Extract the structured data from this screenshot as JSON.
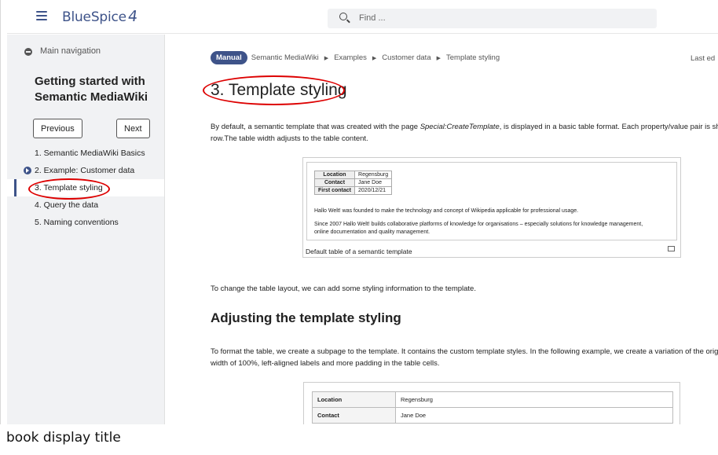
{
  "topbar": {
    "logo_text": "BlueSpice",
    "logo_suffix": "4",
    "search_placeholder": "Find ..."
  },
  "sidebar": {
    "main_navigation": "Main navigation",
    "book_title": "Getting started with Semantic MediaWiki",
    "previous_label": "Previous",
    "next_label": "Next",
    "items": [
      {
        "label": "1. Semantic MediaWiki Basics"
      },
      {
        "label": "2. Example: Customer data"
      },
      {
        "label": "3. Template styling"
      },
      {
        "label": "4. Query the data"
      },
      {
        "label": "5. Naming conventions"
      }
    ]
  },
  "breadcrumb": {
    "badge": "Manual",
    "items": [
      "Semantic MediaWiki",
      "Examples",
      "Customer data",
      "Template styling"
    ],
    "last_edit": "Last ed"
  },
  "content": {
    "title": "3. Template styling",
    "intro_line1_a": "By default, a semantic template that was created with the page ",
    "intro_line1_em": "Special:CreateTemplate",
    "intro_line1_b": ", is displayed in a basic table format. Each property/value pair is shown i",
    "intro_line2": "row.The table width adjusts to the table content.",
    "figure": {
      "rows": [
        {
          "key": "Location",
          "value": "Regensburg"
        },
        {
          "key": "Contact",
          "value": "Jane Doe"
        },
        {
          "key": "First contact",
          "value": "2020/12/21"
        }
      ],
      "text1": "Hallo Welt! was founded to make the technology and concept of Wikipedia applicable for professional usage.",
      "text2a": "Since 2007 Hallo Welt! builds collaborative platforms of knowledge for organisations – especially solutions for knowledge management,",
      "text2b": "online documentation and quality management.",
      "caption": "Default table of a semantic template"
    },
    "change_text": "To change the table layout, we can add some styling information to the template.",
    "heading2": "Adjusting the template styling",
    "format_line1": "To format the table, we create a subpage to the template. It contains the custom template styles. In the following example, we create a variation of the origina",
    "format_line2": "width of 100%, left-aligned labels and more padding in the table cells.",
    "table2": [
      {
        "key": "Location",
        "value": "Regensburg"
      },
      {
        "key": "Contact",
        "value": "Jane Doe"
      }
    ]
  },
  "bottom_caption": "book display title",
  "colors": {
    "brand": "#3e5389",
    "highlight": "#dd0000"
  }
}
